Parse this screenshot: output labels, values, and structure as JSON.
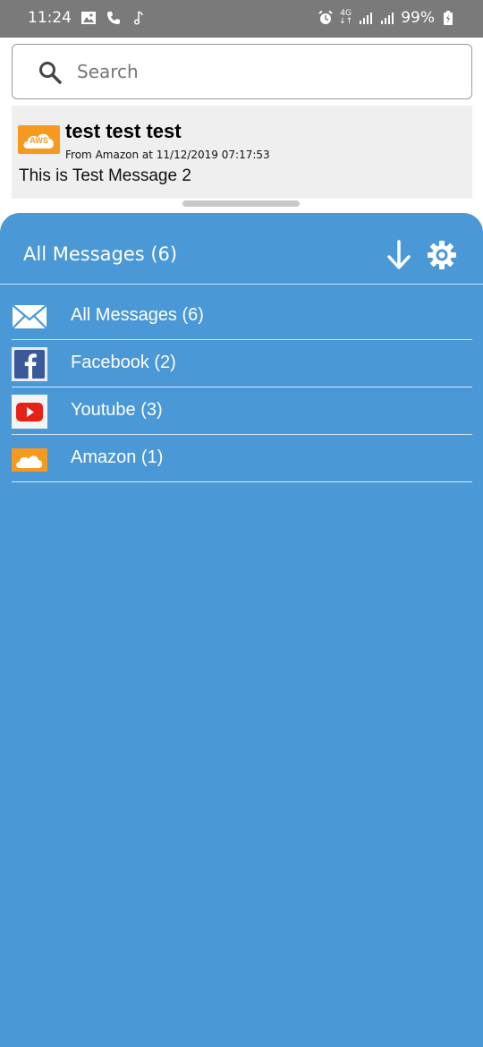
{
  "status_bar": {
    "time": "11:24",
    "network": "4G",
    "battery": "99%"
  },
  "search": {
    "placeholder": "Search"
  },
  "message": {
    "title": "test test test",
    "from_prefix": "From",
    "sender": "Amazon",
    "at_word": "at",
    "timestamp": "11/12/2019 07:17:53",
    "body": "This is Test Message 2",
    "logo_text": "AWS"
  },
  "drawer": {
    "title": "All Messages (6)",
    "items": [
      {
        "label": "All Messages (6)",
        "icon": "envelope-icon"
      },
      {
        "label": "Facebook (2)",
        "icon": "facebook-icon"
      },
      {
        "label": "Youtube (3)",
        "icon": "youtube-icon"
      },
      {
        "label": "Amazon (1)",
        "icon": "aws-icon",
        "icon_text": "AWS"
      }
    ]
  },
  "colors": {
    "drawer_bg": "#4a98d6",
    "aws_orange": "#f69a1f",
    "status_bar": "#7a7a7a"
  }
}
